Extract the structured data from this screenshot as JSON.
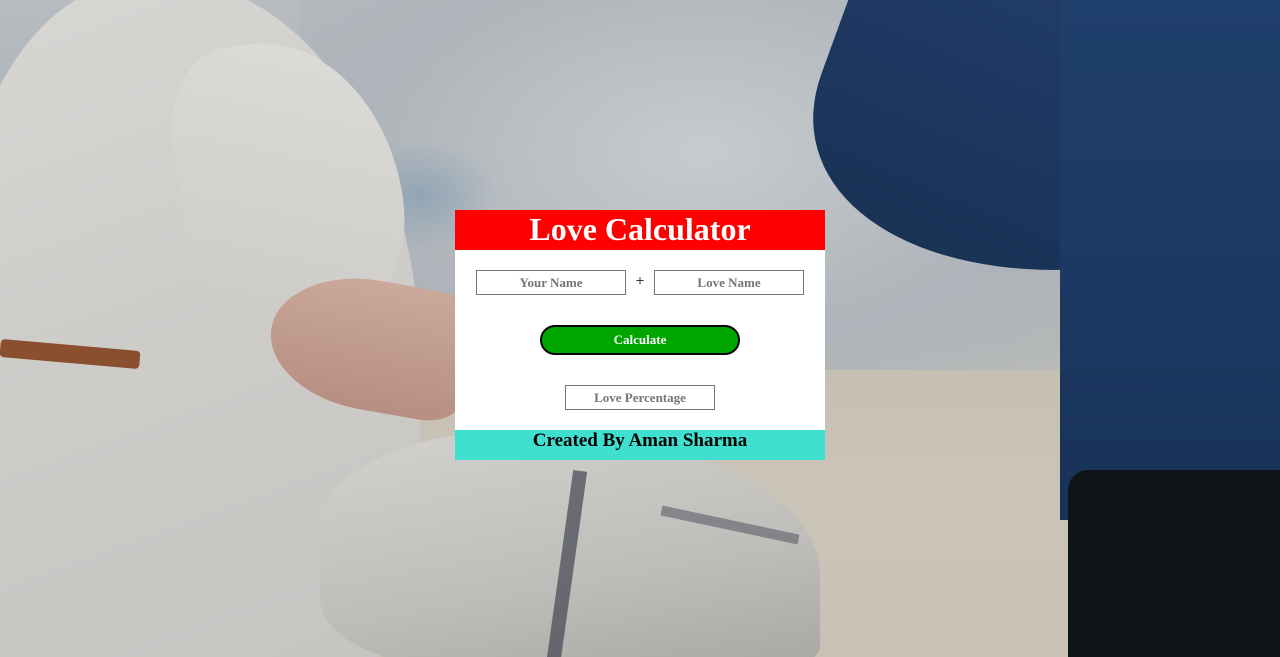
{
  "header": {
    "title": "Love Calculator"
  },
  "form": {
    "your_name_placeholder": "Your Name",
    "plus_sign": "+",
    "love_name_placeholder": "Love Name",
    "calculate_label": "Calculate",
    "result_placeholder": "Love Percentage"
  },
  "footer": {
    "credit": "Created By Aman Sharma"
  },
  "colors": {
    "header_bg": "#ff0000",
    "button_bg": "#00a600",
    "footer_bg": "#40e0d0",
    "card_bg": "#ffffff"
  }
}
